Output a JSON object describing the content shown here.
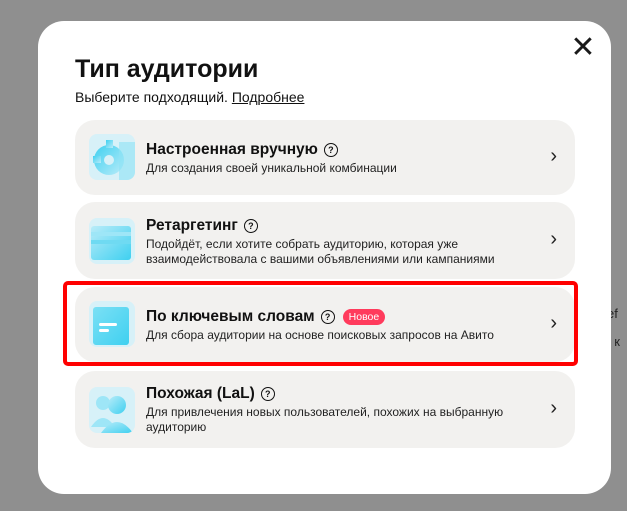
{
  "background_text": [
    "ef",
    ", к"
  ],
  "modal": {
    "title": "Тип аудитории",
    "subtitle": "Выберите подходящий.",
    "more_link": "Подробнее",
    "close_glyph": "✕"
  },
  "options": [
    {
      "title": "Настроенная вручную",
      "description": "Для создания своей уникальной комбинации",
      "icon": "gear-icon"
    },
    {
      "title": "Ретаргетинг",
      "description": "Подойдёт, если хотите собрать аудиторию, которая уже взаимодействовала с вашими объявлениями или кампаниями",
      "icon": "folder-icon"
    },
    {
      "title": "По ключевым словам",
      "badge": "Новое",
      "description": "Для сбора аудитории на основе поисковых запросов на Авито",
      "icon": "document-icon"
    },
    {
      "title": "Похожая (LaL)",
      "description": "Для привлечения новых пользователей, похожих на выбранную аудиторию",
      "icon": "people-icon"
    }
  ],
  "glyphs": {
    "help": "?",
    "chevron": "›"
  },
  "colors": {
    "badge": "#ff3b5c",
    "highlight": "#ff0000",
    "card": "#f2f1ef",
    "icon_gradient_start": "#3fd0f0",
    "icon_gradient_end": "#b9ecf9"
  }
}
